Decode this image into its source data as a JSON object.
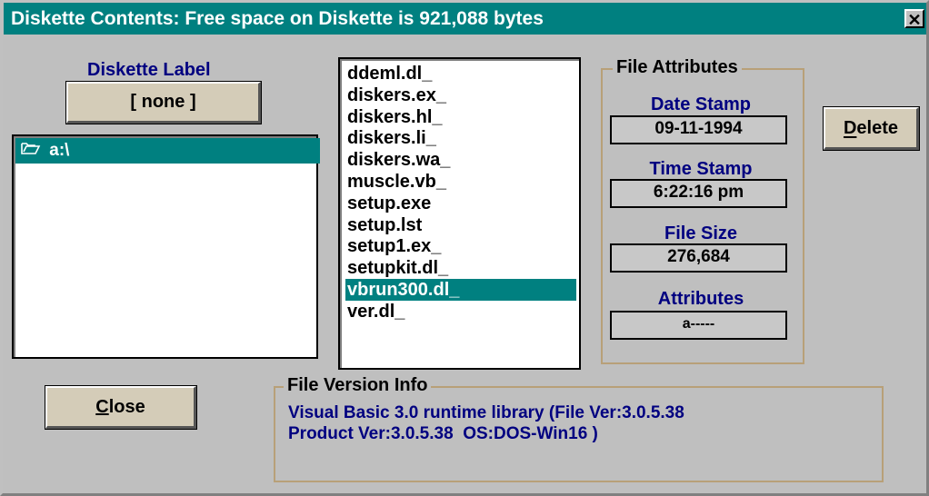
{
  "window": {
    "title": "Diskette Contents: Free space on Diskette is 921,088 bytes",
    "close_glyph": "✕"
  },
  "diskette_label": {
    "heading": "Diskette Label",
    "button_label": "[ none ]"
  },
  "directory": {
    "items": [
      "a:\\"
    ],
    "icon": "open-folder-icon"
  },
  "files": {
    "items": [
      "ddeml.dl_",
      "diskers.ex_",
      "diskers.hl_",
      "diskers.li_",
      "diskers.wa_",
      "muscle.vb_",
      "setup.exe",
      "setup.lst",
      "setup1.ex_",
      "setupkit.dl_",
      "vbrun300.dl_",
      "ver.dl_"
    ],
    "selected_index": 10
  },
  "file_attributes": {
    "group_title": "File Attributes",
    "date_label": "Date Stamp",
    "date_value": "09-11-1994",
    "time_label": "Time Stamp",
    "time_value": "6:22:16 pm",
    "size_label": "File Size",
    "size_value": "276,684",
    "attr_label": "Attributes",
    "attr_value": "a-----"
  },
  "buttons": {
    "delete_label": "Delete",
    "close_label": "Close"
  },
  "version_info": {
    "group_title": "File Version Info",
    "line1": "Visual Basic 3.0 runtime library (File Ver:3.0.5.38",
    "line2": "Product Ver:3.0.5.38  OS:DOS-Win16 )"
  },
  "colors": {
    "titlebar": "#008080",
    "label_blue": "#000080",
    "selection": "#008080",
    "window_bg": "#bfbfbf"
  }
}
